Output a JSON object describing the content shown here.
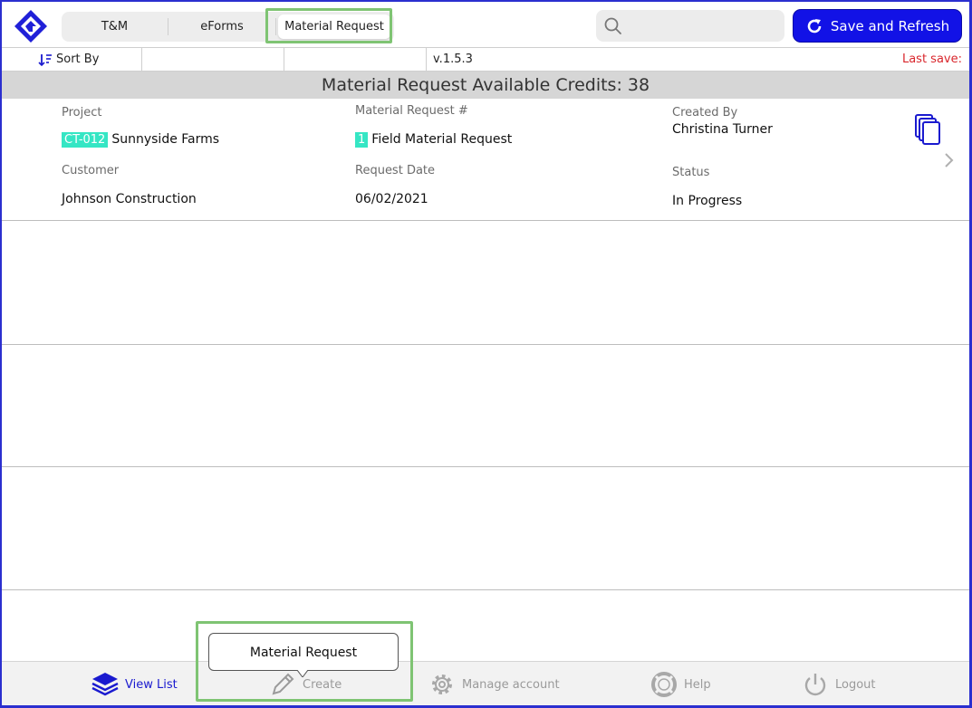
{
  "tabs": [
    {
      "label": "T&M",
      "active": false
    },
    {
      "label": "eForms",
      "active": false
    },
    {
      "label": "Material Request",
      "active": true
    }
  ],
  "search": {
    "placeholder": "",
    "value": ""
  },
  "save_button": {
    "label": "Save and Refresh"
  },
  "sort_bar": {
    "sort_label": "Sort By",
    "version": "v.1.5.3",
    "last_save": "Last save:"
  },
  "credits_banner": "Material Request Available Credits: 38",
  "record": {
    "project_label": "Project",
    "project_code": "CT-012",
    "project_name": "Sunnyside Farms",
    "request_no_label": "Material Request #",
    "request_no": "1",
    "request_title": "Field Material Request",
    "created_by_label": "Created By",
    "created_by": "Christina Turner",
    "customer_label": "Customer",
    "customer": "Johnson Construction",
    "request_date_label": "Request Date",
    "request_date": "06/02/2021",
    "status_label": "Status",
    "status": "In Progress"
  },
  "tooltip": "Material Request",
  "bottom_tabs": [
    {
      "label": "View List",
      "icon": "layers-icon",
      "active": true
    },
    {
      "label": "Create",
      "icon": "pencil-icon",
      "active": false
    },
    {
      "label": "Manage account",
      "icon": "gear-icon",
      "active": false
    },
    {
      "label": "Help",
      "icon": "lifebuoy-icon",
      "active": false
    },
    {
      "label": "Logout",
      "icon": "power-icon",
      "active": false
    }
  ],
  "colors": {
    "accent": "#1212e6",
    "highlight": "#35e6c4",
    "alert": "#d9262c",
    "annotation": "#7fc473"
  }
}
